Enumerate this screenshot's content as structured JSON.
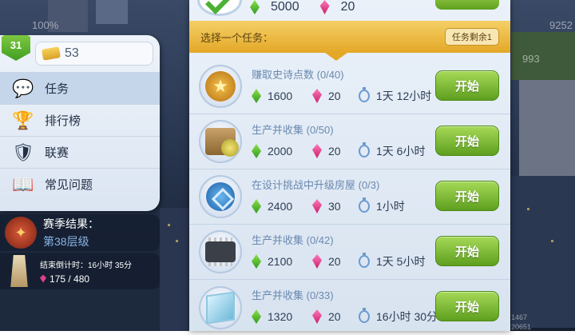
{
  "background": {
    "percent_text": "100%",
    "right_numbers": [
      "9252",
      "993"
    ],
    "bottom_numbers": [
      "1467",
      "20651"
    ]
  },
  "sidebar": {
    "level": "31",
    "tickets": "53",
    "items": [
      {
        "label": "任务",
        "icon": "task-icon",
        "active": true
      },
      {
        "label": "排行榜",
        "icon": "trophy-icon",
        "active": false
      },
      {
        "label": "联赛",
        "icon": "shield-icon",
        "active": false
      },
      {
        "label": "常见问题",
        "icon": "help-book-icon",
        "active": false
      }
    ]
  },
  "season": {
    "title": "赛季结果：",
    "level": "第38层级"
  },
  "countdown": {
    "label": "结束倒计时：16小时 35分",
    "progress": "175 / 480"
  },
  "panel": {
    "previous": {
      "green": "5000",
      "pink": "20"
    },
    "header_title": "选择一个任务：",
    "remaining_badge": "任务剩余1",
    "start_label": "开始",
    "tasks": [
      {
        "name": "赚取史诗点数 (0/40)",
        "green": "1600",
        "pink": "20",
        "time": "1天 12小时",
        "icon": "star-medal-icon"
      },
      {
        "name": "生产并收集 (0/50)",
        "green": "2000",
        "pink": "20",
        "time": "1天 6小时",
        "icon": "crate-icon"
      },
      {
        "name": "在设计挑战中升级房屋 (0/3)",
        "green": "2400",
        "pink": "30",
        "time": "1小时",
        "icon": "design-coin-icon"
      },
      {
        "name": "生产并收集 (0/42)",
        "green": "2100",
        "pink": "20",
        "time": "1天 5小时",
        "icon": "chip-icon"
      },
      {
        "name": "生产并收集 (0/33)",
        "green": "1320",
        "pink": "20",
        "time": "16小时 30分",
        "icon": "glass-icon"
      }
    ]
  }
}
